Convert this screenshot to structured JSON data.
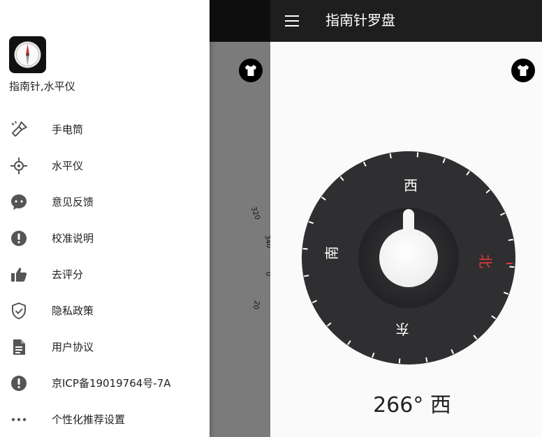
{
  "drawer": {
    "app_name": "指南针,水平仪",
    "items": [
      {
        "label": "手电筒",
        "icon": "flashlight-icon"
      },
      {
        "label": "水平仪",
        "icon": "crosshair-icon"
      },
      {
        "label": "意见反馈",
        "icon": "feedback-chat-icon"
      },
      {
        "label": "校准说明",
        "icon": "alert-circle-icon"
      },
      {
        "label": "去评分",
        "icon": "thumb-up-icon"
      },
      {
        "label": "隐私政策",
        "icon": "shield-check-icon"
      },
      {
        "label": "用户协议",
        "icon": "document-icon"
      },
      {
        "label": "京ICP备19019764号-7A",
        "icon": "alert-circle-icon"
      },
      {
        "label": "个性化推荐设置",
        "icon": "more-horizontal-icon"
      }
    ]
  },
  "appbar": {
    "title": "指南针罗盘"
  },
  "compass": {
    "directions": {
      "north": "北",
      "south": "南",
      "east": "东",
      "west": "西"
    },
    "background_dial_labels": [
      "320",
      "340",
      "0",
      "20"
    ],
    "heading_degrees": "266°",
    "heading_direction": "西"
  },
  "colors": {
    "appbar": "#1e1e1e",
    "dial": "#2f2f31",
    "north_accent": "#e53935",
    "scrim": "#7b7b7b"
  }
}
